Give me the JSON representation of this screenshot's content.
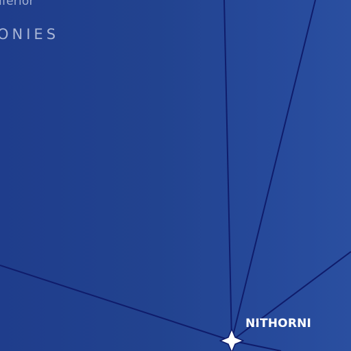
{
  "map": {
    "regions": {
      "top_partial": "ıferior",
      "middle_partial": "ONIES"
    },
    "place": {
      "name": "NITHORNI"
    },
    "colors": {
      "background": "#22438f",
      "route_lines": "#0f1c6b",
      "region_text": "#a9b6d6",
      "place_text": "#ffffff",
      "marker_fill": "#ffffff",
      "marker_outline": "#0f1c6b"
    },
    "icons": {
      "place_marker": "four-point-star-icon"
    }
  }
}
